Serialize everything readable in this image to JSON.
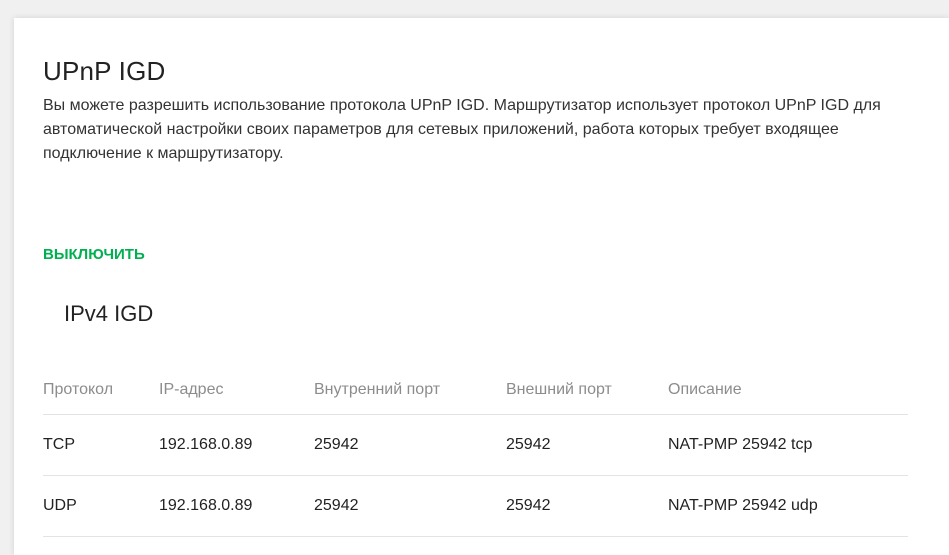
{
  "upnp": {
    "title": "UPnP IGD",
    "description": "Вы можете разрешить использование протокола UPnP IGD. Маршрутизатор использует протокол UPnP IGD для автоматической настройки своих параметров для сетевых приложений, работа которых требует входящее подключение к маршрутизатору.",
    "toggle_label": "ВЫКЛЮЧИТЬ",
    "accent_color": "#00b050"
  },
  "ipv4": {
    "title": "IPv4 IGD",
    "columns": {
      "protocol": "Протокол",
      "ip": "IP-адрес",
      "internal_port": "Внутренний порт",
      "external_port": "Внешний порт",
      "description": "Описание"
    },
    "rows": [
      {
        "protocol": "TCP",
        "ip": "192.168.0.89",
        "internal_port": "25942",
        "external_port": "25942",
        "description": "NAT-PMP 25942 tcp"
      },
      {
        "protocol": "UDP",
        "ip": "192.168.0.89",
        "internal_port": "25942",
        "external_port": "25942",
        "description": "NAT-PMP 25942 udp"
      }
    ]
  }
}
